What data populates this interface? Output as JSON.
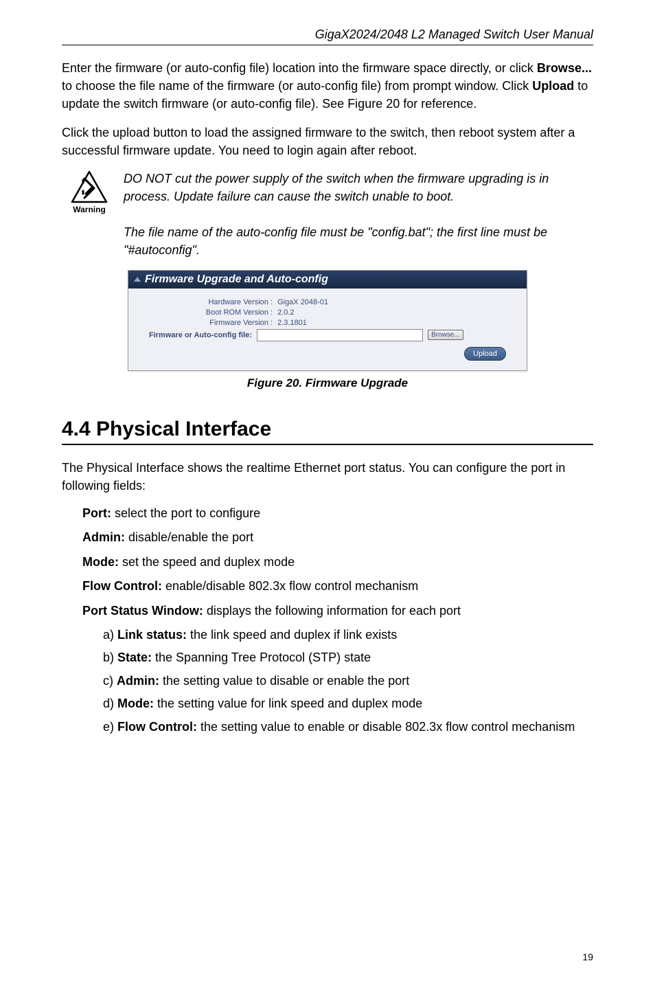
{
  "header": {
    "title": "GigaX2024/2048 L2 Managed Switch User Manual"
  },
  "intro": {
    "p1_prefix": "Enter the firmware (or auto-config file) location into the firmware space directly, or click ",
    "p1_b1": "Browse...",
    "p1_mid": " to choose the file name of the firmware (or auto-config file) from prompt window. Click ",
    "p1_b2": "Upload",
    "p1_suffix": " to update the switch firmware (or auto-config file). See Figure 20 for reference.",
    "p2": "Click the upload button to load the assigned firmware to the switch, then reboot system after a successful firmware update. You need to login again after reboot."
  },
  "warning": {
    "caption": "Warning",
    "note1": "DO NOT cut the power supply of the switch when the firmware upgrading is in process. Update failure can cause the switch unable to boot.",
    "note2": "The file name of the auto-config file must be \"config.bat\"; the first line must be \"#autoconfig\"."
  },
  "screenshot": {
    "title": "Firmware Upgrade and Auto-config",
    "rows": {
      "hw_label": "Hardware Version :",
      "hw_value": "GigaX 2048-01",
      "boot_label": "Boot ROM Version :",
      "boot_value": "2.0.2",
      "fw_label": "Firmware Version :",
      "fw_value": "2.3.1801",
      "file_label": "Firmware or Auto-config file:"
    },
    "browse_btn": "Browse...",
    "upload_btn": "Upload"
  },
  "figure_caption": "Figure 20. Firmware Upgrade",
  "section": {
    "title": "4.4 Physical Interface",
    "intro": "The Physical Interface shows the realtime Ethernet port status. You can configure the port in following fields:",
    "fields": {
      "port_b": "Port:",
      "port_t": " select the port to configure",
      "admin_b": "Admin:",
      "admin_t": " disable/enable the port",
      "mode_b": "Mode:",
      "mode_t": " set the speed and duplex mode",
      "flow_b": "Flow Control:",
      "flow_t": " enable/disable 802.3x flow control mechanism",
      "psw_b": "Port Status Window:",
      "psw_t": " displays the following information for each port"
    },
    "sublist": {
      "a_prefix": "a) ",
      "a_b": "Link status:",
      "a_t": " the link speed and duplex if link exists",
      "b_prefix": "b) ",
      "b_b": "State:",
      "b_t": " the Spanning Tree Protocol (STP) state",
      "c_prefix": "c) ",
      "c_b": "Admin:",
      "c_t": " the setting value to disable or enable the port",
      "d_prefix": "d) ",
      "d_b": "Mode:",
      "d_t": " the setting value for link speed and duplex mode",
      "e_prefix": "e) ",
      "e_b": "Flow Control:",
      "e_t": " the setting value to enable or disable 802.3x flow control mechanism"
    }
  },
  "page_number": "19"
}
